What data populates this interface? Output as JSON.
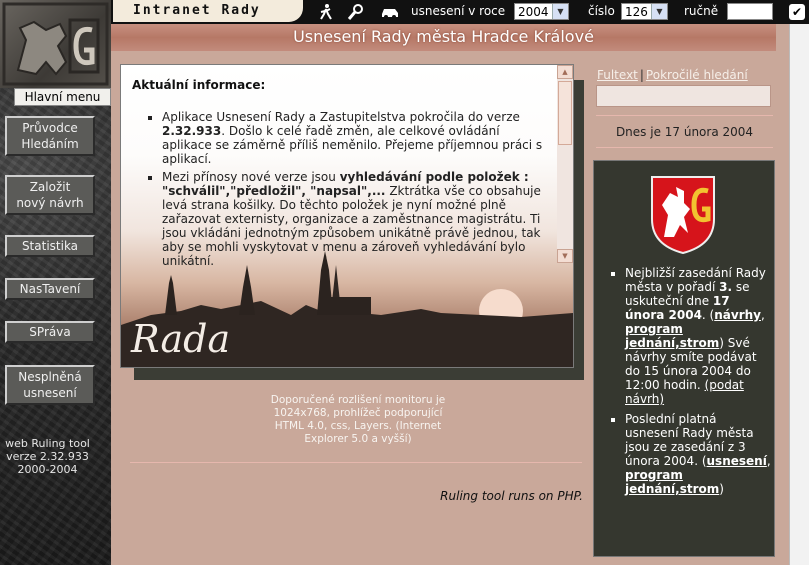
{
  "topbar": {
    "app_title": "Intranet Rady",
    "label_resolution_year": "usnesení v roce",
    "year_value": "2004",
    "label_number": "číslo",
    "number_value": "126",
    "label_manual": "ručně",
    "manual_value": ""
  },
  "page_title": "Usnesení Rady města Hradce Králové",
  "sidebar": {
    "main_menu": "Hlavní menu",
    "buttons": [
      {
        "line1": "Průvodce",
        "line2": "Hledáním"
      },
      {
        "line1": "Založit",
        "line2": "nový návrh"
      },
      {
        "line1": "Statistika",
        "line2": ""
      },
      {
        "line1": "NasTavení",
        "line2": ""
      },
      {
        "line1": "SPráva",
        "line2": ""
      },
      {
        "line1": "Nesplněná",
        "line2": "usnesení"
      }
    ],
    "footer": [
      "web Ruling tool",
      "verze 2.32.933",
      "2000-2004"
    ]
  },
  "content": {
    "heading": "Aktuální informace:",
    "item1_a": "Aplikace Usnesení Rady a Zastupitelstva pokročila do verze ",
    "item1_version": "2.32.933",
    "item1_b": ". Došlo k celé řadě změn, ale celkové ovládání aplikace se záměrně příliš neměnilo. Přejeme příjemnou práci s aplikací.",
    "item2_a": "Mezi přínosy nové verze jsou ",
    "item2_bold": "vyhledávání podle položek : \"schválil\",\"předložil\", \"napsal\",...",
    "item2_b": " Zktrátka vše co obsahuje levá strana košilky. Do těchto položek je nyní možné plně zařazovat externisty, organizace a zaměstnance magistrátu. Ti jsou vkládáni jednotným způsobem unikátně právě jednou, tak aby se mohli vyskytovat v menu a zároveň vyhledávání bylo unikátní.",
    "image_caption": "Rada"
  },
  "notice": "Doporučené rozlišení monitoru je 1024x768, prohlížeč podporující HTML 4.0, css, Layers. (Internet Explorer 5.0 a vyšší)",
  "ruling_note": "Ruling tool runs on PHP.",
  "right": {
    "link_fulltext": "Fultext",
    "link_separator": "|",
    "link_advanced": "Pokročilé hledání",
    "search_value": "",
    "date_text": "Dnes je 17 února 2004",
    "news1_a": "Nejbližší zasedání Rady města v pořadí ",
    "news1_order": "3.",
    "news1_b": " se uskuteční dne ",
    "news1_date": "17 února 2004",
    "news1_c": ". (",
    "news1_link1": "návrhy",
    "news1_d": ", ",
    "news1_link2": "program jednání,strom",
    "news1_e": ") Své návrhy smíte podávat do 15 února 2004 do 12:00 hodin.",
    "news1_link3": "(podat návrh)",
    "news2_a": "Poslední platná usnesení Rady města jsou ze zasedání z 3 února 2004. (",
    "news2_link1": "usnesení",
    "news2_b": ", ",
    "news2_link2": "program jednání,strom",
    "news2_c": ")"
  },
  "colors": {
    "accent": "#c9a89a",
    "title_banner": "#b67866",
    "info_box": "#35372f"
  },
  "icons": [
    "walker-icon",
    "magnifier-icon",
    "car-icon",
    "checkbox-icon",
    "coat-of-arms-icon",
    "lion-relief-logo"
  ]
}
